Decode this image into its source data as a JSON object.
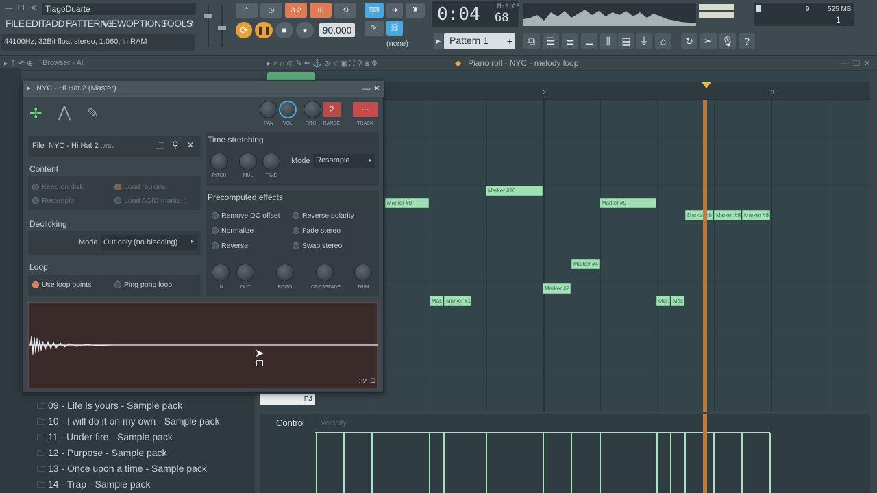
{
  "top": {
    "user": "TiagoDuarte",
    "menu": [
      "FILE",
      "EDIT",
      "ADD",
      "PATTERNS",
      "VIEW",
      "OPTIONS",
      "TOOLS",
      "?"
    ],
    "hint": "44100Hz, 32Bit float stereo, 1:060, in RAM",
    "snap_value": "3.2",
    "tempo": "90,000",
    "time_main": "0:04",
    "time_ms": "68",
    "time_unit": "M:S:CS",
    "none_label": "(none)",
    "pattern": "Pattern 1",
    "cpu_value": "9",
    "ram": "525 MB",
    "voices": "1"
  },
  "toolbar2": {
    "browser_label": "Browser - All",
    "piano_roll_title": "Piano roll - NYC - melody loop"
  },
  "ruler": {
    "marks": [
      "2",
      "3"
    ]
  },
  "notes": [
    {
      "label": "Marker #9"
    },
    {
      "label": "Marker #10"
    },
    {
      "label": "Marker #9"
    },
    {
      "label": "Marker #8"
    },
    {
      "label": "Marker #8"
    },
    {
      "label": "Marker #8"
    },
    {
      "label": "Marker #4"
    },
    {
      "label": "Marker #2"
    },
    {
      "label": "Mar."
    },
    {
      "label": "Marker #1"
    },
    {
      "label": "Mar."
    },
    {
      "label": "Mar."
    }
  ],
  "piano_key_label": "E4",
  "control": {
    "label": "Control",
    "lane": "Velocity"
  },
  "sample": {
    "title": "NYC - Hi Hat 2 (Master)",
    "knob_labels": [
      "PAN",
      "VOL",
      "PITCH",
      "RANGE",
      "TRACK"
    ],
    "range_value": "2",
    "track_value": "---",
    "file_label": "File",
    "file_name": "NYC - Hi Hat 2",
    "file_ext": ".wav",
    "content_title": "Content",
    "keep_on_disk": "Keep on disk",
    "load_regions": "Load regions",
    "resample": "Resample",
    "load_acid": "Load ACID markers",
    "declicking_title": "Declicking",
    "mode_label": "Mode",
    "declick_mode": "Out only (no bleeding)",
    "loop_title": "Loop",
    "use_loop": "Use loop points",
    "ping_pong": "Ping pong loop",
    "ts_title": "Time stretching",
    "ts_knobs": [
      "PITCH",
      "MUL",
      "TIME"
    ],
    "ts_mode_label": "Mode",
    "ts_mode": "Resample",
    "pre_title": "Precomputed effects",
    "fx": [
      "Remove DC offset",
      "Reverse polarity",
      "Normalize",
      "Fade stereo",
      "Reverse",
      "Swap stereo"
    ],
    "fx_knobs": [
      "IN",
      "OUT",
      "POGO",
      "CROSSFADE",
      "TRIM"
    ],
    "zoom": "32"
  },
  "browser_items": [
    "09 - Life is yours - Sample pack",
    "10 - I will do it on my own - Sample pack",
    "11 - Under fire - Sample pack",
    "12 - Purpose - Sample pack",
    "13 - Once upon a time - Sample pack",
    "14 - Trap - Sample pack"
  ],
  "colors": {
    "note": "#9fe0b4",
    "playhead": "#c07a3a",
    "accent": "#e07a52"
  }
}
